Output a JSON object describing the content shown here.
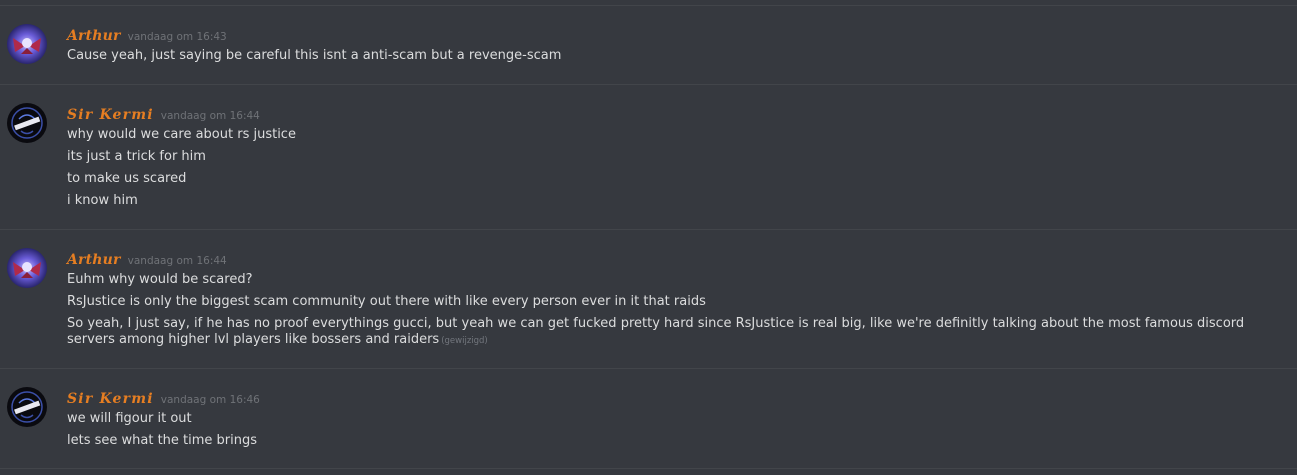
{
  "messages": [
    {
      "author": "Arthur",
      "timestamp": "vandaag om 16:43",
      "avatar": "arthur-avatar",
      "lines": [
        "Cause yeah, just saying be careful this isnt a anti-scam but a revenge-scam"
      ]
    },
    {
      "author": "Sir Kermi",
      "timestamp": "vandaag om 16:44",
      "avatar": "kermi-avatar",
      "lines": [
        "why would we care about rs justice",
        "its just a trick for him",
        "to make us scared",
        "i know him"
      ]
    },
    {
      "author": "Arthur",
      "timestamp": "vandaag om 16:44",
      "avatar": "arthur-avatar",
      "lines": [
        "Euhm why would be scared?",
        "RsJustice is only the biggest scam community out there with like every person ever in it that raids",
        "So yeah, I just say, if he has no proof everythings gucci, but yeah we can get fucked pretty hard since RsJustice is real big, like we're definitly talking about the most famous discord servers among higher lvl players like bossers and raiders"
      ],
      "edited_label": "(gewijzigd)"
    },
    {
      "author": "Sir Kermi",
      "timestamp": "vandaag om 16:46",
      "avatar": "kermi-avatar",
      "lines": [
        "we will figour it out",
        "lets see what the time brings"
      ]
    }
  ],
  "colors": {
    "background": "#36393f",
    "username": "#e67e22",
    "text": "#dcddde",
    "timestamp": "#6f7277"
  }
}
